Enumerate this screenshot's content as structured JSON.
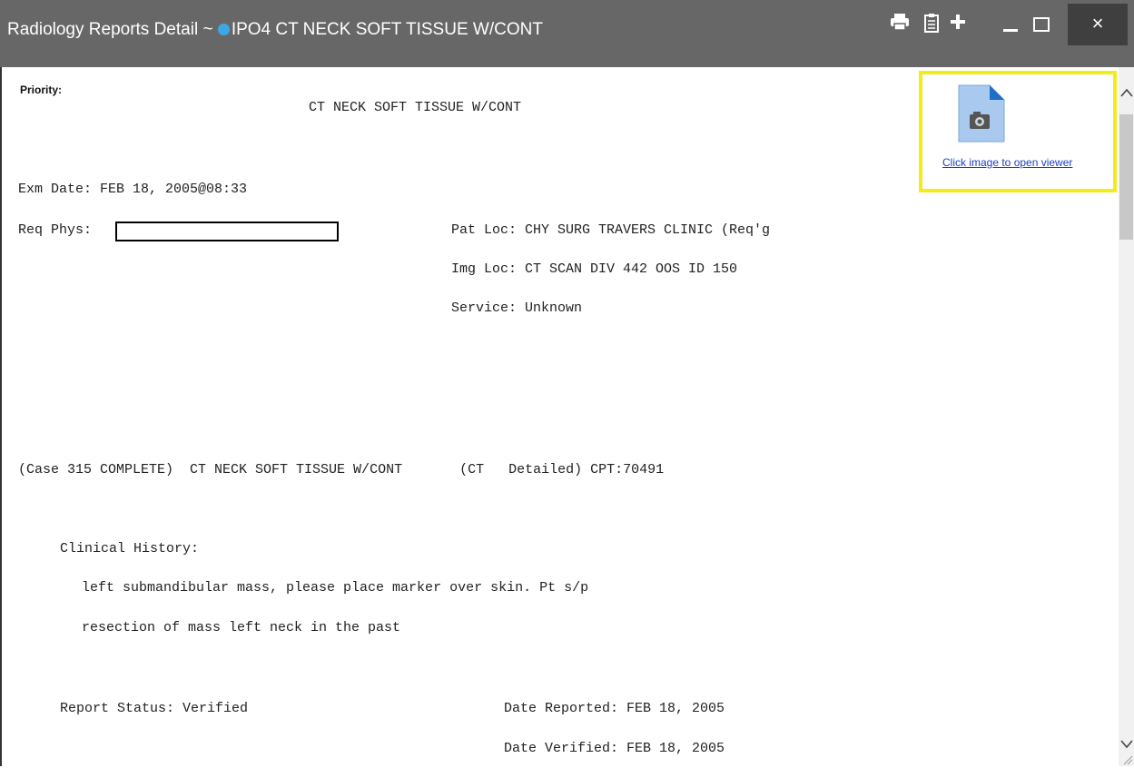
{
  "window": {
    "title_prefix": "Radiology Reports Detail ~",
    "title_main": "IPO4 CT NECK SOFT TISSUE W/CONT",
    "accent_dot_color": "#3ba7e4",
    "titlebar_color": "#676767",
    "buttons": {
      "print_icon": "print-icon",
      "clipboard_icon": "clipboard-icon",
      "add_icon": "plus-icon",
      "minimize_icon": "minimize-icon",
      "maximize_icon": "maximize-icon",
      "close_label": "×"
    }
  },
  "report": {
    "priority_label": "Priority:",
    "exam_title": "CT NECK SOFT TISSUE W/CONT",
    "exm_date": "Exm Date: FEB 18, 2005@08:33",
    "req_phys_label": "Req Phys:",
    "pat_loc": "Pat Loc: CHY SURG TRAVERS CLINIC (Req'g",
    "img_loc": "Img Loc: CT SCAN DIV 442 OOS ID 150",
    "service": "Service: Unknown",
    "case_line": "(Case 315 COMPLETE)  CT NECK SOFT TISSUE W/CONT       (CT   Detailed) CPT:70491",
    "clinical_history_label": "Clinical History:",
    "clinical_history_line1": "left submandibular mass, please place marker over skin. Pt s/p",
    "clinical_history_line2": "resection of mass left neck in the past",
    "report_status": "Report Status: Verified",
    "date_reported": "Date Reported: FEB 18, 2005",
    "date_verified": "Date Verified: FEB 18, 2005"
  },
  "viewer": {
    "icon": "image-file-icon",
    "link_text": "Click image to open viewer",
    "highlight_color": "#f2ec1c"
  }
}
